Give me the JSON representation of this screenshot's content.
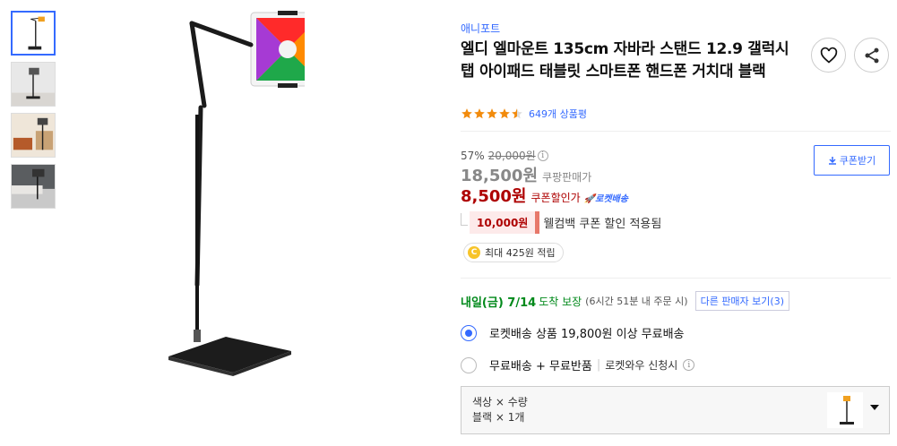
{
  "colors": {
    "accent": "#346aff",
    "sale_red": "#ae0000",
    "green": "#00891a",
    "star": "#f28b0c"
  },
  "gallery": {
    "thumbnails": [
      {
        "name": "stand-white-bg",
        "active": true
      },
      {
        "name": "stand-room",
        "active": false
      },
      {
        "name": "stand-living-room",
        "active": false
      },
      {
        "name": "stand-bed",
        "active": false
      }
    ]
  },
  "product": {
    "brand": "애니포트",
    "title": "엘디 엘마운트 135cm 자바라 스탠드 12.9 갤럭시탭 아이패드 태블릿 스마트폰 핸드폰 거치대 블랙",
    "rating_stars": 4.5,
    "review_count": "649개 상품평"
  },
  "price": {
    "discount_rate": "57%",
    "original": "20,000원",
    "info_icon": "i",
    "coupang_price": "18,500원",
    "coupang_label": "쿠팡판매가",
    "coupon_price": "8,500원",
    "coupon_label": "쿠폰할인가",
    "rocket_badge": "🚀로켓배송",
    "coupon_button": "쿠폰받기",
    "welcome_amount": "10,000원",
    "welcome_text": "웰컴백 쿠폰 할인 적용됨",
    "points_coin": "C",
    "points_text": "최대 425원 적립"
  },
  "delivery": {
    "arrival": "내일(금) 7/14",
    "arrival_sub": "도착 보장",
    "deadline": "(6시간 51분 내 주문 시)",
    "other_sellers": "다른 판매자 보기(3)"
  },
  "options": {
    "rocket": {
      "label": "로켓배송 상품 19,800원 이상 무료배송",
      "checked": true
    },
    "free": {
      "label": "무료배송 + 무료반품",
      "sep": "|",
      "sub": "로켓와우 신청시",
      "checked": false
    }
  },
  "selector": {
    "header": "색상 × 수량",
    "value": "블랙 × 1개"
  }
}
